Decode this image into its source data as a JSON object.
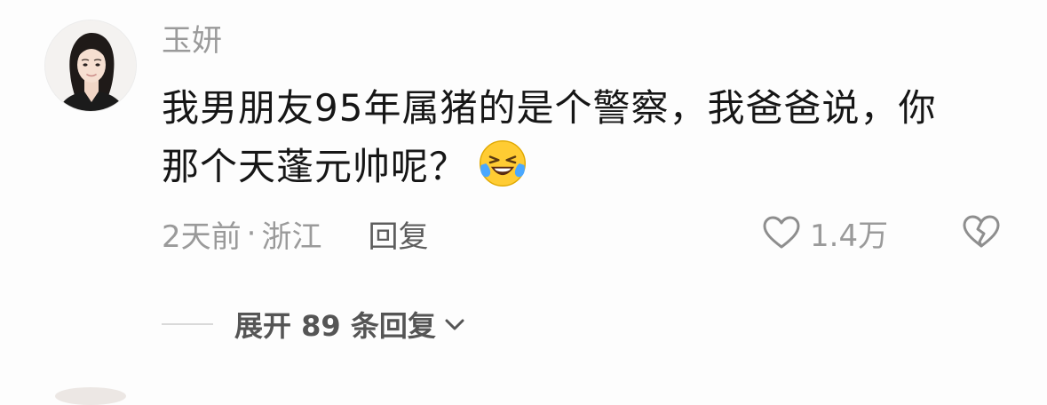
{
  "comment": {
    "username": "玉妍",
    "content_line1": "我男朋友95年属猪的是个警察，我爸爸说，你",
    "content_line2": "那个天蓬元帅呢？",
    "emoji": "laughing-with-tears-emoji",
    "time": "2天前",
    "separator": "·",
    "location": "浙江",
    "reply_label": "回复",
    "likes": "1.4万",
    "like_icon": "heart-outline-icon",
    "dislike_icon": "broken-heart-icon"
  },
  "replies": {
    "expand_label": "展开 89 条回复",
    "chevron_icon": "chevron-down-icon"
  },
  "colors": {
    "meta_gray": "#9a9a9a",
    "text": "#161616",
    "reply_gray": "#5d5d5d",
    "expand_gray": "#555555"
  }
}
